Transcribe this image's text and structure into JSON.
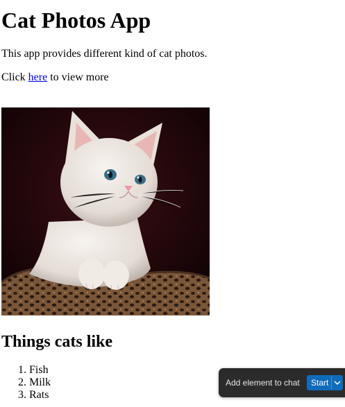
{
  "page": {
    "title": "Cat Photos App",
    "intro": "This app provides different kind of cat photos.",
    "more_prefix": "Click ",
    "more_link": "here",
    "more_suffix": " to view more"
  },
  "photo": {
    "icon": "kitten-photo"
  },
  "likes": {
    "heading": "Things cats like",
    "items": [
      {
        "num": "1.",
        "label": "Fish"
      },
      {
        "num": "2.",
        "label": "Milk"
      },
      {
        "num": "3.",
        "label": "Rats"
      }
    ]
  },
  "overlay": {
    "label": "Add element to chat",
    "start": "Start",
    "chevron_icon": "chevron-down-icon",
    "accent": "#0f6cbd"
  }
}
